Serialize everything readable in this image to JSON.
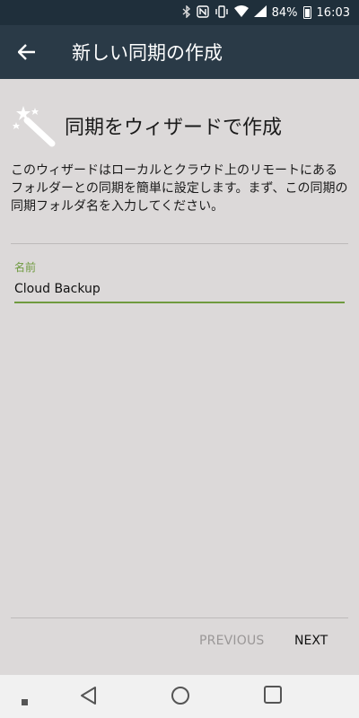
{
  "status_bar": {
    "battery": "84%",
    "time": "16:03",
    "icons": [
      "bluetooth-icon",
      "nfc-icon",
      "vibrate-icon",
      "wifi-icon",
      "signal-icon",
      "battery-icon"
    ]
  },
  "app_bar": {
    "title": "新しい同期の作成",
    "back_icon": "back-arrow-icon"
  },
  "wizard": {
    "icon": "magic-wand-icon",
    "title": "同期をウィザードで作成",
    "description": "このウィザードはローカルとクラウド上のリモートにあるフォルダーとの同期を簡単に設定します。まず、この同期の同期フォルダ名を入力してください。"
  },
  "name_field": {
    "label": "名前",
    "value": "Cloud Backup"
  },
  "buttons": {
    "previous": "PREVIOUS",
    "next": "NEXT"
  },
  "colors": {
    "status_bar": "#1f2f3b",
    "app_bar": "#2a3a47",
    "background": "#dcd9d9",
    "accent": "#6f9a3f",
    "disabled_text": "#9a9797"
  }
}
